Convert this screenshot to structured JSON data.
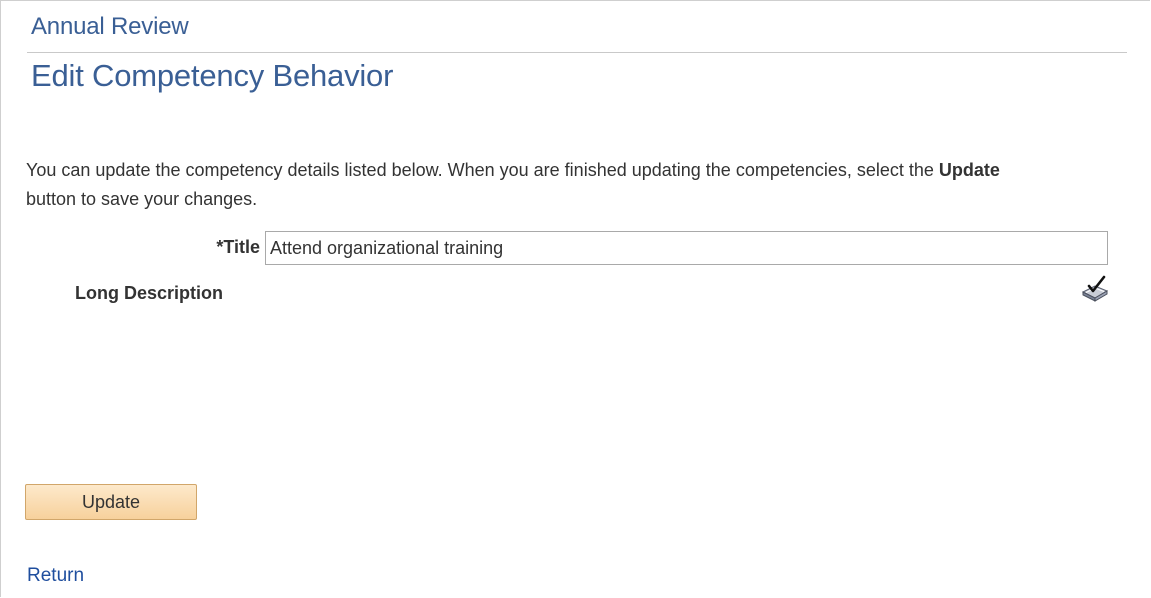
{
  "header": {
    "breadcrumb": "Annual Review",
    "page_title": "Edit Competency Behavior"
  },
  "instructions": {
    "before": "You can update the competency details listed below. When you are finished updating the competencies, select the ",
    "bold": "Update",
    "after": " button to save your changes."
  },
  "form": {
    "title_label": "*Title",
    "title_value": "Attend organizational training",
    "long_description_label": "Long Description",
    "spell_check_icon": "spell-check-icon"
  },
  "actions": {
    "update_label": "Update",
    "return_label": "Return"
  },
  "colors": {
    "heading": "#3a5f95",
    "link": "#1f4e9e",
    "button_fill": "#f7d19c"
  }
}
